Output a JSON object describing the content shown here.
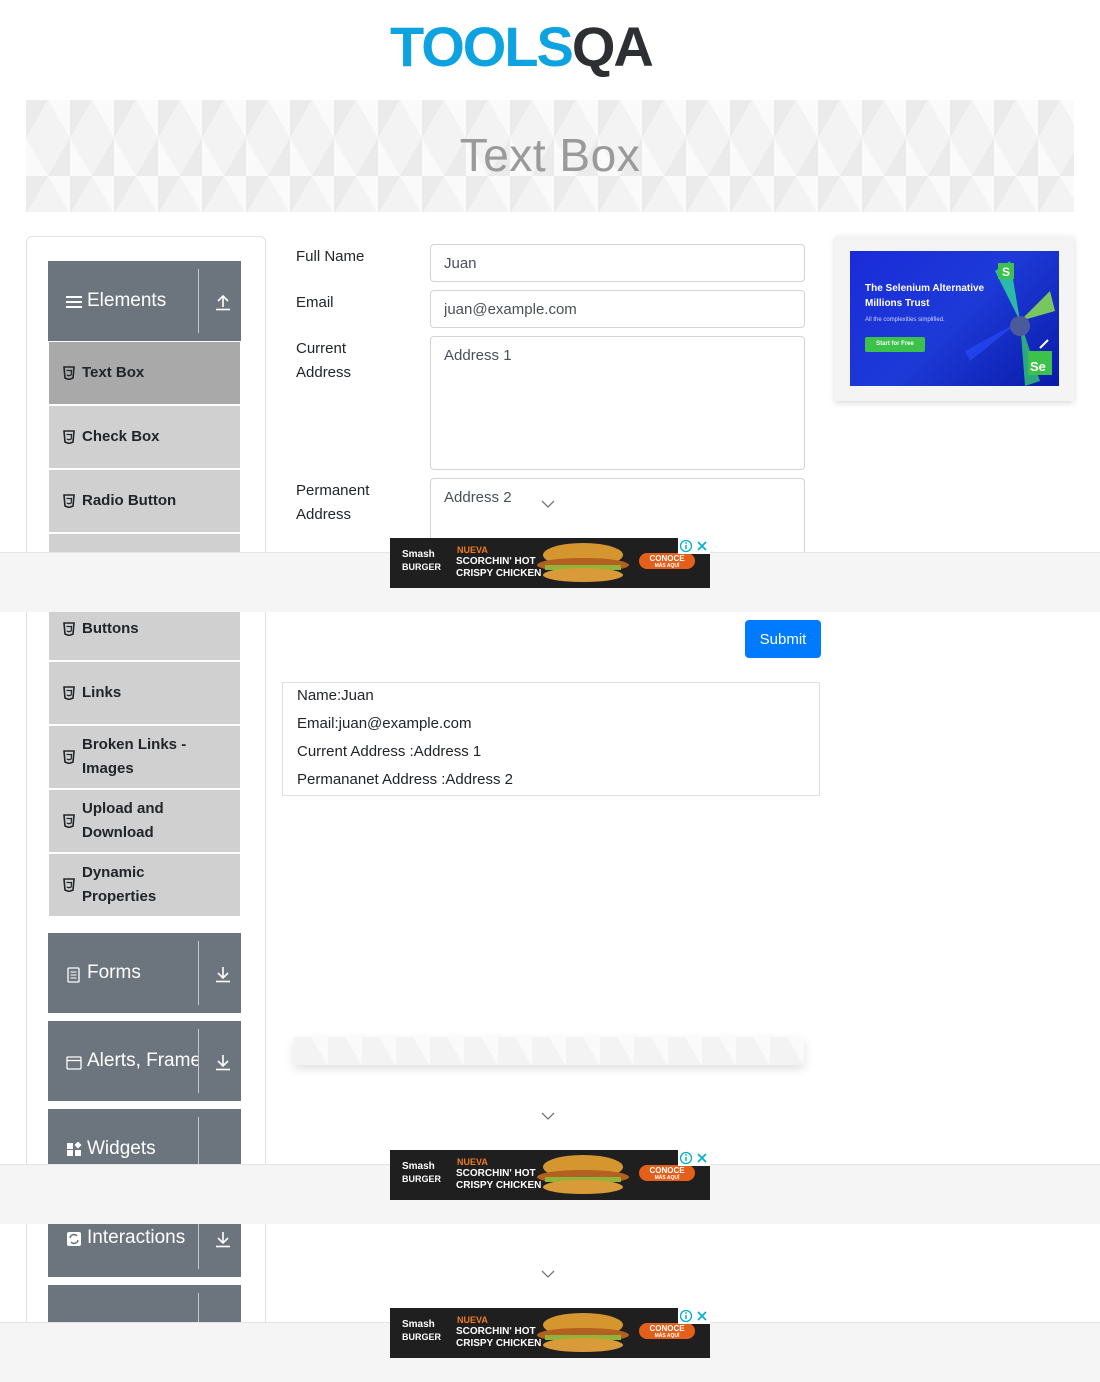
{
  "brand": {
    "logo_text": "TOOLSQA"
  },
  "banner": {
    "title": "Text Box"
  },
  "sidebar": {
    "groups": [
      {
        "label": "Elements",
        "icon": "hamburger-icon",
        "expanded": true
      },
      {
        "label": "Forms",
        "icon": "form-icon",
        "expanded": false
      },
      {
        "label": "Alerts, Frame & Windows",
        "icon": "window-icon",
        "expanded": false
      },
      {
        "label": "Widgets",
        "icon": "widgets-icon",
        "expanded": false
      },
      {
        "label": "Interactions",
        "icon": "interactions-icon",
        "expanded": false
      }
    ],
    "items": [
      {
        "label": "Text Box",
        "active": true
      },
      {
        "label": "Check Box"
      },
      {
        "label": "Radio Button"
      },
      {
        "label": "Buttons"
      },
      {
        "label": "Links"
      },
      {
        "label": "Broken Links - Images"
      },
      {
        "label": "Upload and Download"
      },
      {
        "label": "Dynamic Properties"
      }
    ]
  },
  "form": {
    "full_name_label": "Full Name",
    "full_name_value": "Juan",
    "email_label": "Email",
    "email_value": "juan@example.com",
    "current_address_label": "Current Address",
    "current_address_value": "Address 1",
    "permanent_address_label": "Permanent Address",
    "permanent_address_value": "Address 2",
    "submit_label": "Submit"
  },
  "output": {
    "name": "Name:Juan",
    "email": "Email:juan@example.com",
    "current_address": "Current Address :Address 1",
    "permanent_address": "Permananet Address :Address 2"
  },
  "ads": {
    "selenium": {
      "headline_1": "The Selenium Alternative",
      "headline_2": "Millions Trust",
      "subtext": "All the complexities simplified.",
      "cta": "Start for Free"
    },
    "burger": {
      "brand_line_1": "Smash",
      "brand_line_2": "BURGER",
      "kicker": "NUEVA",
      "headline_1": "SCORCHIN' HOT",
      "headline_2": "CRISPY CHICKEN",
      "cta": "CONOCE",
      "cta_sub": "MÁS AQUÍ"
    }
  },
  "colors": {
    "sidebar_header": "#6c757d",
    "menu_item": "#d0d0d0",
    "menu_item_active": "#a9a9a9",
    "submit": "#007bff",
    "logo_blue": "#0da3e0",
    "logo_dark": "#2d2f33"
  }
}
